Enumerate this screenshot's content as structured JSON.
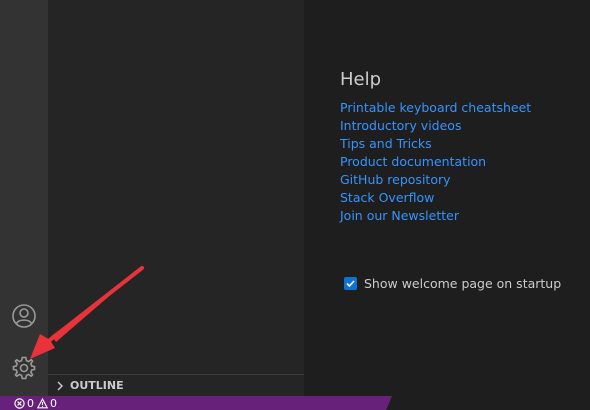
{
  "sidebar": {
    "outline_label": "OUTLINE"
  },
  "welcome": {
    "help_title": "Help",
    "help_links": [
      "Printable keyboard cheatsheet",
      "Introductory videos",
      "Tips and Tricks",
      "Product documentation",
      "GitHub repository",
      "Stack Overflow",
      "Join our Newsletter"
    ],
    "show_on_startup_label": "Show welcome page on startup",
    "show_on_startup_checked": true
  },
  "status_bar": {
    "errors": "0",
    "warnings": "0"
  },
  "colors": {
    "link": "#3794ff",
    "status_bar": "#68217a",
    "checkbox": "#0e71d6",
    "annotation_arrow": "#e8333a"
  },
  "icons": {
    "accounts": "account-icon",
    "manage": "gear-icon",
    "outline_chevron": "chevron-right-icon",
    "errors": "error-icon",
    "warnings": "warning-icon",
    "checkbox": "checkmark-icon"
  }
}
